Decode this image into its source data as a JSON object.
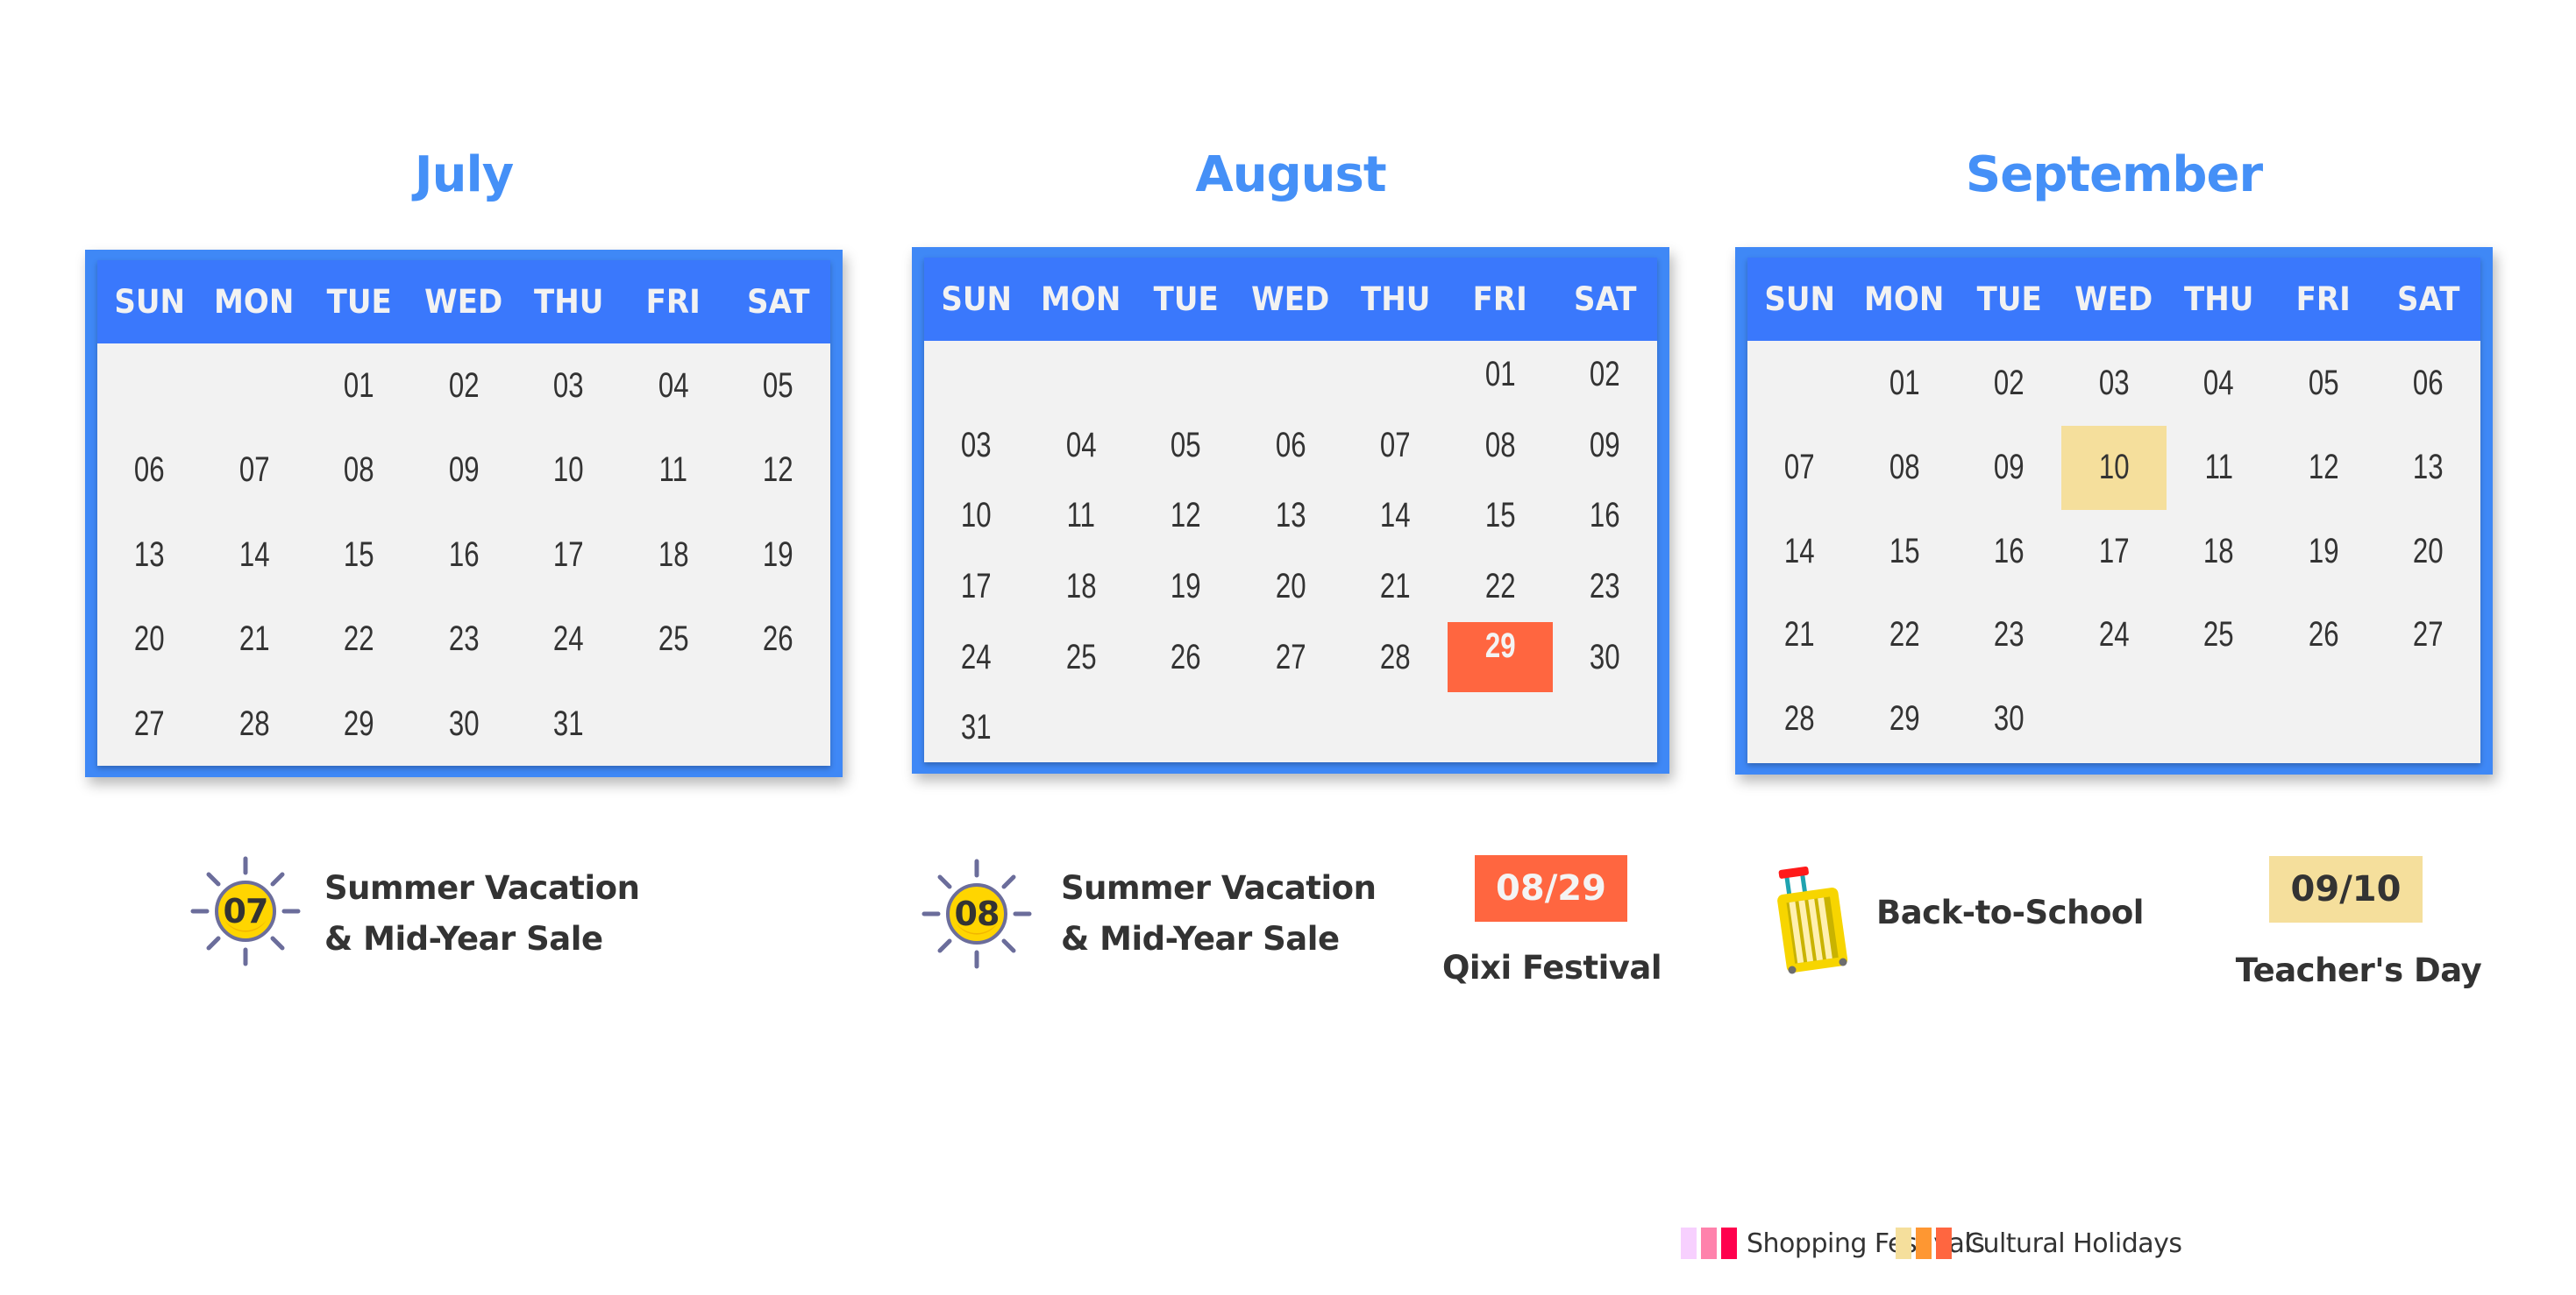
{
  "weekdays": [
    "SUN",
    "MON",
    "TUE",
    "WED",
    "THU",
    "FRI",
    "SAT"
  ],
  "months": [
    {
      "name": "July",
      "weeks": [
        [
          "",
          "",
          "01",
          "02",
          "03",
          "04",
          "05"
        ],
        [
          "06",
          "07",
          "08",
          "09",
          "10",
          "11",
          "12"
        ],
        [
          "13",
          "14",
          "15",
          "16",
          "17",
          "18",
          "19"
        ],
        [
          "20",
          "21",
          "22",
          "23",
          "24",
          "25",
          "26"
        ],
        [
          "27",
          "28",
          "29",
          "30",
          "31",
          "",
          ""
        ]
      ],
      "highlights": []
    },
    {
      "name": "August",
      "weeks": [
        [
          "",
          "",
          "",
          "",
          "",
          "01",
          "02"
        ],
        [
          "03",
          "04",
          "05",
          "06",
          "07",
          "08",
          "09"
        ],
        [
          "10",
          "11",
          "12",
          "13",
          "14",
          "15",
          "16"
        ],
        [
          "17",
          "18",
          "19",
          "20",
          "21",
          "22",
          "23"
        ],
        [
          "24",
          "25",
          "26",
          "27",
          "28",
          "29",
          "30"
        ],
        [
          "31",
          "",
          "",
          "",
          "",
          "",
          ""
        ]
      ],
      "highlights": [
        {
          "day": "29",
          "category": "cultural",
          "color": "#ff6640"
        }
      ]
    },
    {
      "name": "September",
      "weeks": [
        [
          "",
          "01",
          "02",
          "03",
          "04",
          "05",
          "06"
        ],
        [
          "07",
          "08",
          "09",
          "10",
          "11",
          "12",
          "13"
        ],
        [
          "14",
          "15",
          "16",
          "17",
          "18",
          "19",
          "20"
        ],
        [
          "21",
          "22",
          "23",
          "24",
          "25",
          "26",
          "27"
        ],
        [
          "28",
          "29",
          "30",
          "",
          "",
          "",
          ""
        ]
      ],
      "highlights": [
        {
          "day": "10",
          "category": "cultural",
          "color": "#f5df9c"
        }
      ]
    }
  ],
  "events": {
    "july": {
      "icon": "sun-icon",
      "icon_label": "07",
      "line1": "Summer Vacation",
      "line2": "& Mid-Year Sale"
    },
    "august": {
      "icon": "sun-icon",
      "icon_label": "08",
      "line1": "Summer Vacation",
      "line2": "& Mid-Year Sale",
      "festival_date": "08/29",
      "festival_name": "Qixi Festival"
    },
    "september": {
      "icon": "suitcase-icon",
      "line1": "Back-to-School",
      "festival_date": "09/10",
      "festival_name": "Teacher's Day"
    }
  },
  "legend": [
    {
      "label": "Shopping Festivals",
      "colors": [
        "#f7d0fe",
        "#ff82ac",
        "#ff004d"
      ]
    },
    {
      "label": "Cultural Holidays",
      "colors": [
        "#f5df9c",
        "#fe9732",
        "#ff6640"
      ]
    }
  ],
  "colors": {
    "title": "#4590f7",
    "header": "#3a78fc",
    "frame": "#3f88f6",
    "body": "#f2f2f2",
    "text": "#333333",
    "sun_yellow": "#ffd500",
    "sun_ray": "#6b6d9b"
  }
}
